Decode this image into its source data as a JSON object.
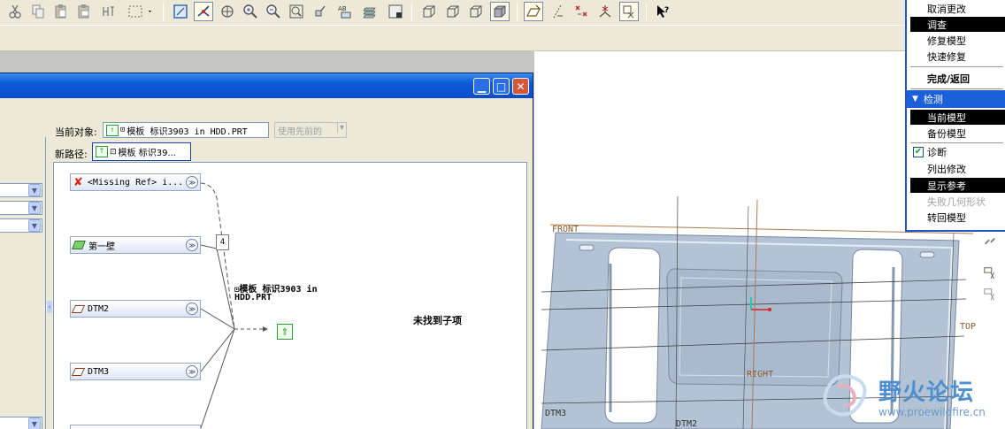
{
  "colors": {
    "title_bar": "#0a5ad8",
    "menu_header": "#1b60d8",
    "model_surface": "#b3c3d5",
    "datum": "#b07a4a"
  },
  "toolbar": {
    "icons": [
      "cut-icon",
      "copy-icon",
      "paste-icon",
      "paste-special-icon",
      "regenerate-icon",
      "select-box-icon",
      "repaint-icon",
      "spin-center-icon",
      "orient-icon",
      "zoom-in-icon",
      "zoom-out-icon",
      "refit-icon",
      "named-view-icon",
      "layers-icon",
      "model-tree-icon",
      "wireframe-icon",
      "hidden-line-icon",
      "no-hidden-icon",
      "shading-icon",
      "datum-planes-icon",
      "datum-axes-icon",
      "datum-points-icon",
      "coordinate-systems-icon",
      "spin-center-toggle-icon",
      "context-help-icon"
    ]
  },
  "dialog": {
    "current_object_label": "当前对象:",
    "current_object_value": "模板 标识3903 in HDD.PRT",
    "use_previous_label": "使用先前的",
    "new_path_label": "新路径:",
    "new_path_value": "模板 标识39...",
    "nodes": [
      {
        "label": "<Missing Ref> i...",
        "icon": "missing-ref-icon"
      },
      {
        "label": "第一壁",
        "icon": "first-wall-icon"
      },
      {
        "label": "DTM2",
        "icon": "datum-plane-icon"
      },
      {
        "label": "DTM3",
        "icon": "datum-plane-icon"
      }
    ],
    "ref_count": "4",
    "target_name_line1": "模板 标识3903 in",
    "target_name_line2": "HDD.PRT",
    "no_children": "未找到子项"
  },
  "menu": {
    "items": [
      {
        "label": "取消更改",
        "state": "normal"
      },
      {
        "label": "调查",
        "state": "selected"
      },
      {
        "label": "修复模型",
        "state": "normal"
      },
      {
        "label": "快速修复",
        "state": "normal"
      },
      {
        "label": "完成/返回",
        "state": "bold"
      }
    ],
    "section_header": "检测",
    "section_items": [
      {
        "label": "当前模型",
        "state": "selected"
      },
      {
        "label": "备份模型",
        "state": "normal"
      },
      {
        "label": "诊断",
        "state": "checked"
      },
      {
        "label": "列出修改",
        "state": "normal"
      },
      {
        "label": "显示参考",
        "state": "selected"
      },
      {
        "label": "失败几何形状",
        "state": "disabled"
      },
      {
        "label": "转回模型",
        "state": "normal"
      }
    ]
  },
  "viewport": {
    "datum_labels": [
      "FRONT",
      "TOP",
      "RIGHT",
      "DTM3",
      "DTM2"
    ]
  },
  "watermark": {
    "title": "野火论坛",
    "url": "www.proewildfire.cn"
  }
}
